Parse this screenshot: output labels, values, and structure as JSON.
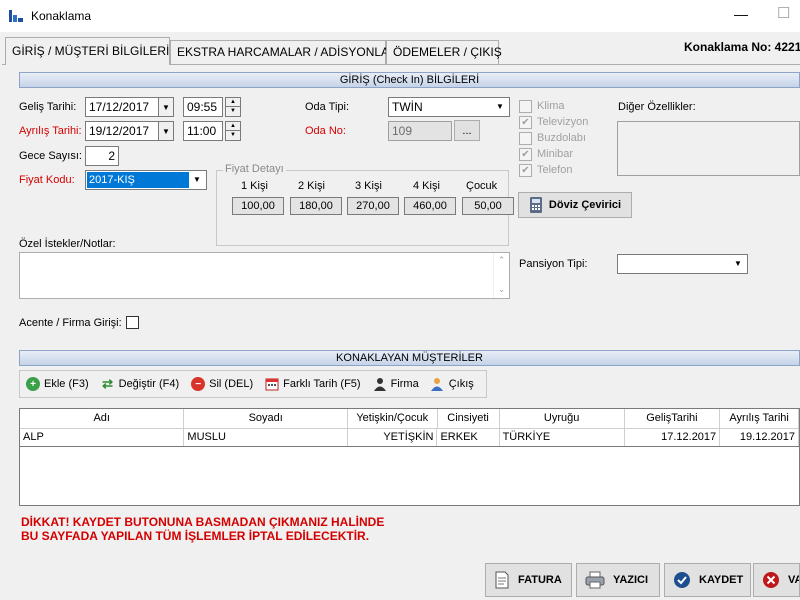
{
  "window": {
    "title": "Konaklama"
  },
  "tabs": [
    {
      "label": "GİRİŞ / MÜŞTERİ BİLGİLERİ"
    },
    {
      "label": "EKSTRA HARCAMALAR / ADİSYONLAR"
    },
    {
      "label": "ÖDEMELER / ÇIKIŞ"
    }
  ],
  "header": {
    "konaklama_no": "Konaklama No: 4221"
  },
  "checkin_section": {
    "title": "GİRİŞ (Check In) BİLGİLERİ"
  },
  "form": {
    "gelis_tarihi_label": "Geliş Tarihi:",
    "gelis_tarihi": "17/12/2017",
    "gelis_saati": "09:55",
    "ayrilis_tarihi_label": "Ayrılış Tarihi:",
    "ayrilis_tarihi": "19/12/2017",
    "ayrilis_saati": "11:00",
    "gece_sayisi_label": "Gece Sayısı:",
    "gece_sayisi": "2",
    "fiyat_kodu_label": "Fiyat Kodu:",
    "fiyat_kodu": "2017-KIŞ",
    "oda_tipi_label": "Oda Tipi:",
    "oda_tipi": "TWİN",
    "oda_no_label": "Oda No:",
    "oda_no": "109",
    "oda_no_browse": "...",
    "ozel_istekler_label": "Özel İstekler/Notlar:",
    "ozel_istekler": "",
    "acente_label": "Acente / Firma Girişi:",
    "pansiyon_label": "Pansiyon Tipi:",
    "pansiyon": "",
    "diger_ozellikler_label": "Diğer Özellikler:"
  },
  "features": [
    {
      "label": "Klima",
      "checked": false
    },
    {
      "label": "Televizyon",
      "checked": true
    },
    {
      "label": "Buzdolabı",
      "checked": false
    },
    {
      "label": "Minibar",
      "checked": true
    },
    {
      "label": "Telefon",
      "checked": true
    }
  ],
  "fiyat_detayi": {
    "title": "Fiyat Detayı",
    "columns": [
      {
        "label": "1 Kişi",
        "value": "100,00"
      },
      {
        "label": "2 Kişi",
        "value": "180,00"
      },
      {
        "label": "3 Kişi",
        "value": "270,00"
      },
      {
        "label": "4 Kişi",
        "value": "460,00"
      },
      {
        "label": "Çocuk",
        "value": "50,00"
      }
    ]
  },
  "doviz_button": "Döviz Çevirici",
  "guests_section": {
    "title": "KONAKLAYAN MÜŞTERİLER"
  },
  "toolbar": [
    {
      "label": "Ekle (F3)",
      "icon": "add-icon"
    },
    {
      "label": "Değiştir (F4)",
      "icon": "swap-icon"
    },
    {
      "label": "Sil (DEL)",
      "icon": "delete-icon"
    },
    {
      "label": "Farklı Tarih (F5)",
      "icon": "calendar-icon"
    },
    {
      "label": "Firma",
      "icon": "company-icon"
    },
    {
      "label": "Çıkış",
      "icon": "checkout-icon"
    }
  ],
  "grid": {
    "columns": [
      "Adı",
      "Soyadı",
      "Yetişkin/Çocuk",
      "Cinsiyeti",
      "Uyruğu",
      "GelişTarihi",
      "Ayrılış Tarihi"
    ],
    "rows": [
      [
        "ALP",
        "MUSLU",
        "YETİŞKİN",
        "ERKEK",
        "TÜRKİYE",
        "17.12.2017",
        "19.12.2017"
      ]
    ]
  },
  "warning": {
    "line1": "DİKKAT! KAYDET BUTONUNA BASMADAN ÇIKMANIZ HALİNDE",
    "line2": "BU SAYFADA YAPILAN TÜM İŞLEMLER  İPTAL EDİLECEKTİR."
  },
  "bottom_buttons": [
    {
      "label": "FATURA",
      "icon": "invoice-icon"
    },
    {
      "label": "YAZICI",
      "icon": "printer-icon"
    },
    {
      "label": "KAYDET",
      "icon": "save-icon"
    },
    {
      "label": "VAZGEÇ",
      "icon": "cancel-icon"
    }
  ],
  "colors": {
    "warning": "#d40000",
    "section_bar": "#c5d3e8",
    "selected": "#0078d7"
  }
}
